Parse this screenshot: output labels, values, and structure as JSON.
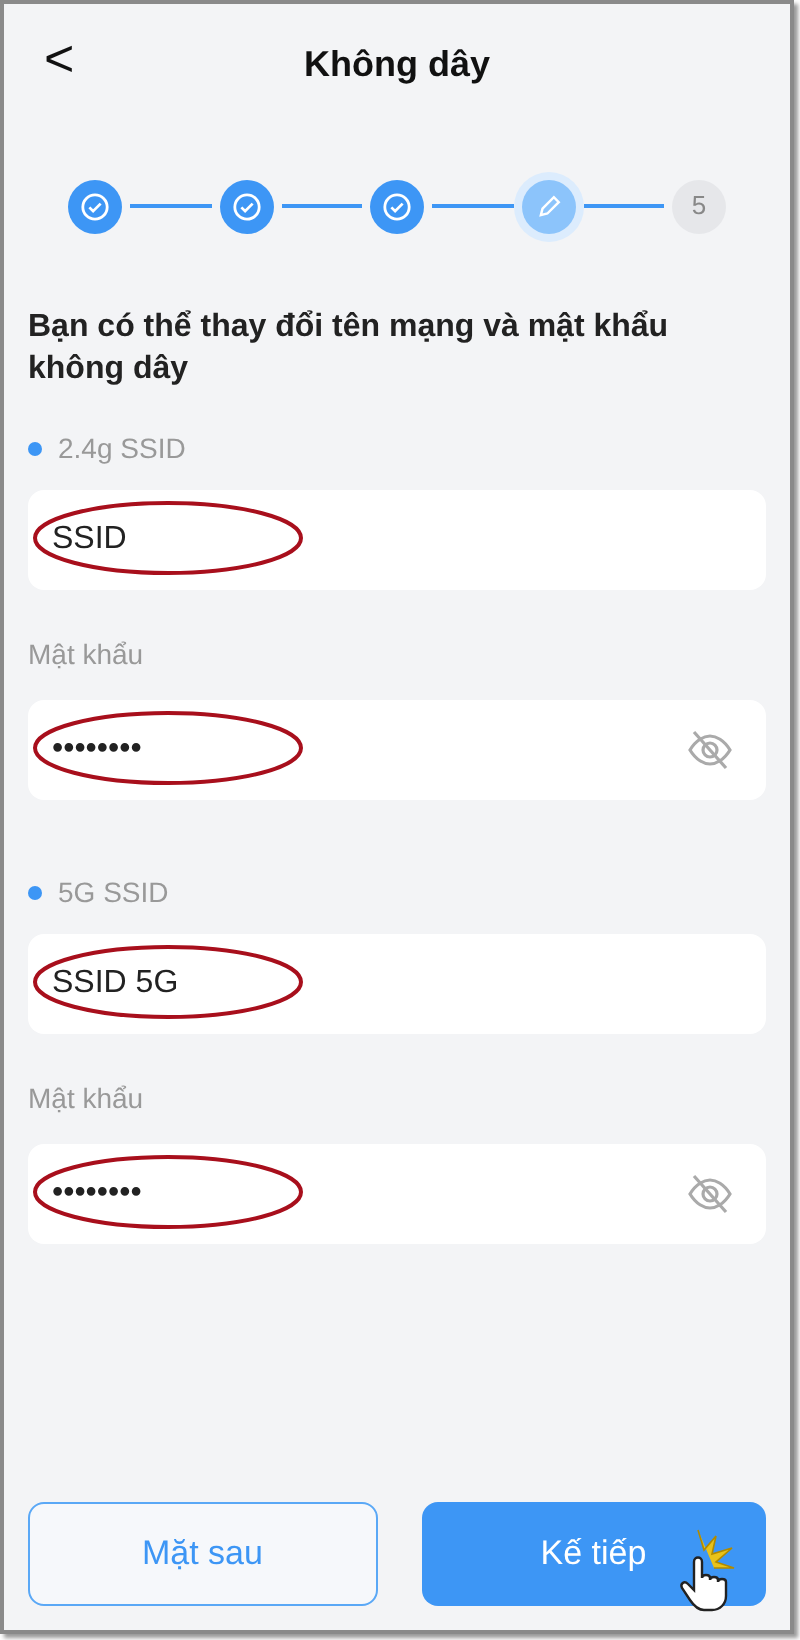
{
  "header": {
    "back": "<",
    "title": "Không dây"
  },
  "steps": [
    {
      "kind": "done"
    },
    {
      "kind": "done"
    },
    {
      "kind": "done"
    },
    {
      "kind": "current"
    },
    {
      "kind": "pending",
      "label": "5"
    }
  ],
  "heading": "Bạn có thể thay đổi tên mạng và mật khẩu không dây",
  "networks": [
    {
      "band_label": "2.4g SSID",
      "ssid": {
        "value": "SSID",
        "highlighted": true
      },
      "password_label": "Mật khẩu",
      "password": {
        "value": "••••••••",
        "highlighted": true,
        "visible": false
      }
    },
    {
      "band_label": "5G SSID",
      "ssid": {
        "value": "SSID 5G",
        "highlighted": true
      },
      "password_label": "Mật khẩu",
      "password": {
        "value": "••••••••",
        "highlighted": true,
        "visible": false
      }
    }
  ],
  "buttons": [
    {
      "kind": "outline",
      "label": "Mặt sau",
      "clicked": false
    },
    {
      "kind": "primary",
      "label": "Kế tiếp",
      "clicked": true
    }
  ]
}
